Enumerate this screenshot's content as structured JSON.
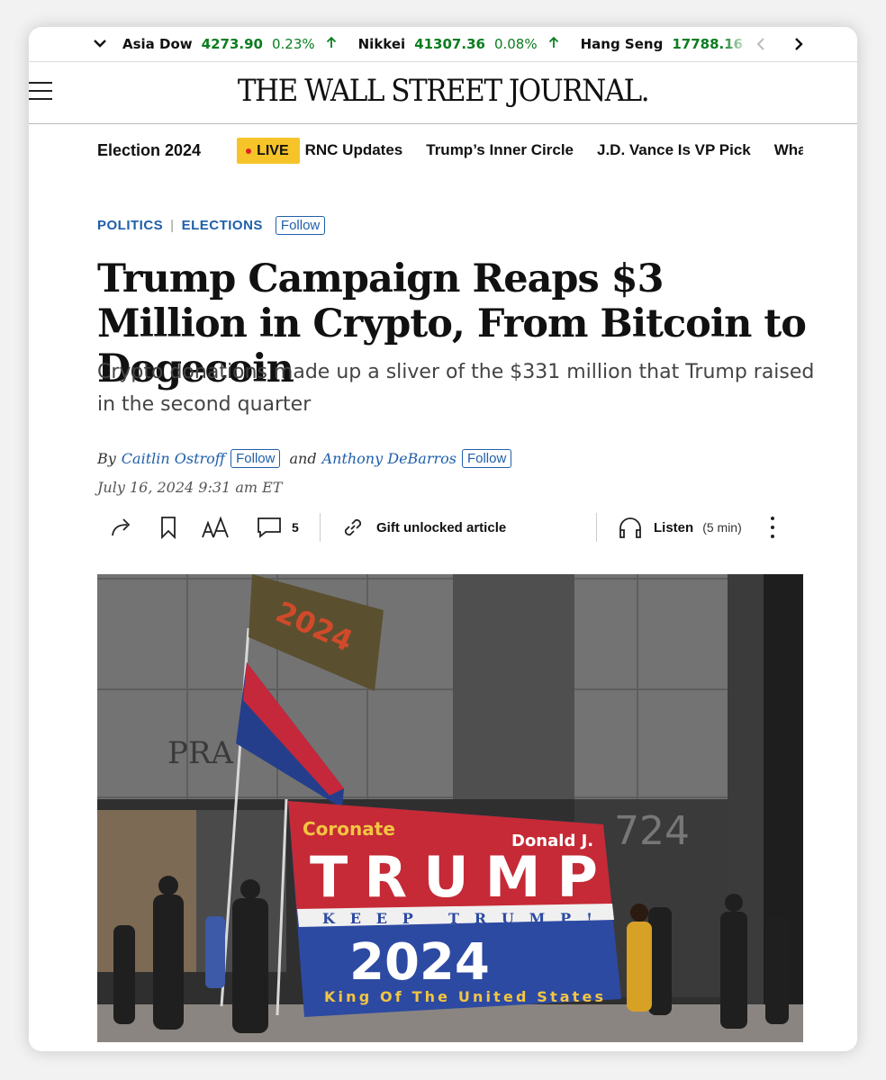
{
  "ticker": {
    "items": [
      {
        "name": "Asia Dow",
        "value": "4273.90",
        "change": "0.23%"
      },
      {
        "name": "Nikkei",
        "value": "41307.36",
        "change": "0.08%"
      },
      {
        "name": "Hang Seng",
        "value": "17788.16",
        "change": "("
      }
    ],
    "colors": {
      "up": "#0a7d1f"
    }
  },
  "masthead": {
    "logo": "THE WALL STREET JOURNAL."
  },
  "election_nav": {
    "section": "Election 2024",
    "live_label": "LIVE",
    "links": [
      "RNC Updates",
      "Trump’s Inner Circle",
      "J.D. Vance Is VP Pick",
      "What"
    ]
  },
  "article": {
    "kicker": [
      "POLITICS",
      "ELECTIONS"
    ],
    "follow_label": "Follow",
    "headline": "Trump Campaign Reaps $3 Million in Crypto, From Bitcoin to Dogecoin",
    "dek": "Crypto donations made up a sliver of the $331 million that Trump raised in the second quarter",
    "byline": {
      "by": "By",
      "authors": [
        "Caitlin Ostroff",
        "Anthony DeBarros"
      ],
      "and": "and"
    },
    "date": "July 16, 2024 9:31 am ET"
  },
  "toolbar": {
    "comments_count": "5",
    "gift_label": "Gift unlocked article",
    "listen_label": "Listen",
    "listen_duration": "(5 min)"
  },
  "photo": {
    "banner_top": "Coronate",
    "banner_name": "Donald J.",
    "banner_main": "TRUMP",
    "banner_middle": "KEEP TRUMP!",
    "banner_year": "2024",
    "banner_bottom": "King Of The United States",
    "flag_text": "2024",
    "building_text": "PRA",
    "address": "724"
  }
}
